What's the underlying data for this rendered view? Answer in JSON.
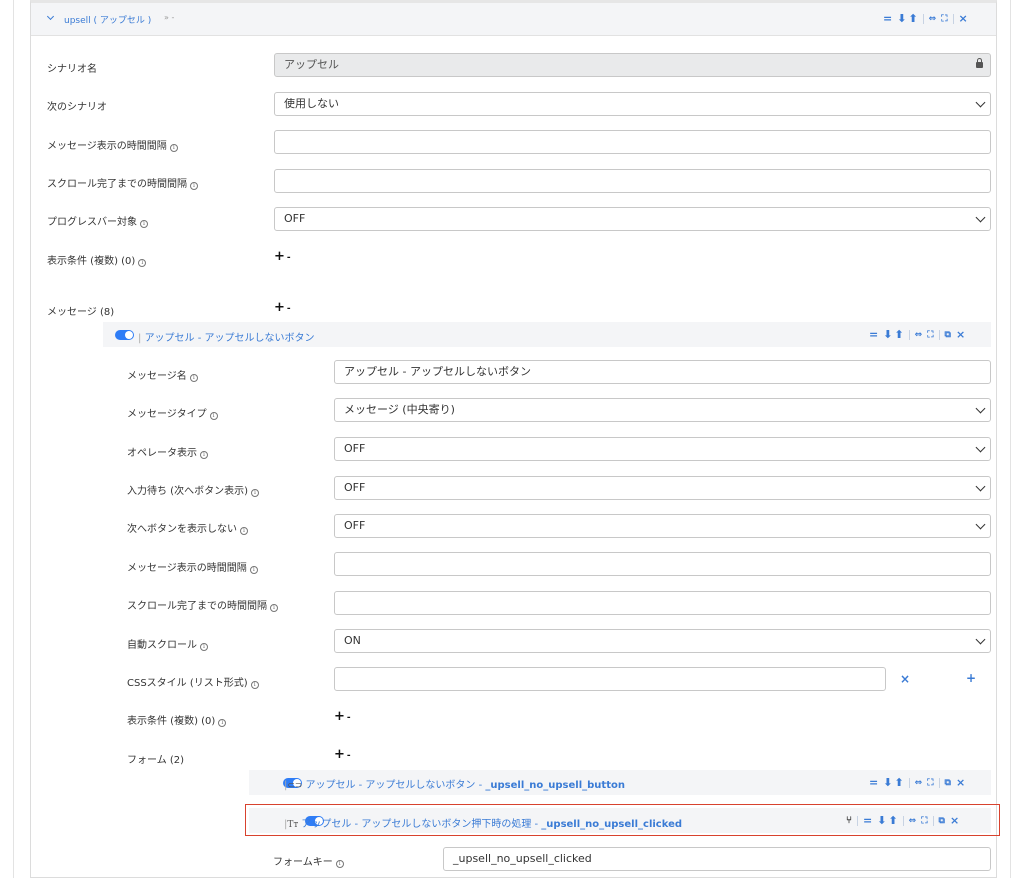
{
  "scenario": {
    "title": "upsell ( アップセル )",
    "title_suffix": "» -",
    "fields": {
      "scenario_name_label": "シナリオ名",
      "scenario_name_value": "アップセル",
      "next_scenario_label": "次のシナリオ",
      "next_scenario_value": "使用しない",
      "message_interval_label": "メッセージ表示の時間間隔",
      "scroll_interval_label": "スクロール完了までの時間間隔",
      "progress_bar_label": "プログレスバー対象",
      "progress_bar_value": "OFF",
      "display_conditions_label": "表示条件 (複数) (0)",
      "messages_label": "メッセージ (8)"
    }
  },
  "message": {
    "title": "アップセル - アップセルしないボタン",
    "fields": {
      "name_label": "メッセージ名",
      "name_value": "アップセル - アップセルしないボタン",
      "type_label": "メッセージタイプ",
      "type_value": "メッセージ (中央寄り)",
      "operator_label": "オペレータ表示",
      "operator_value": "OFF",
      "wait_input_label": "入力待ち (次へボタン表示)",
      "wait_input_value": "OFF",
      "hide_next_label": "次へボタンを表示しない",
      "hide_next_value": "OFF",
      "interval_label": "メッセージ表示の時間間隔",
      "scroll_label": "スクロール完了までの時間間隔",
      "autoscroll_label": "自動スクロール",
      "autoscroll_value": "ON",
      "css_label": "CSSスタイル (リスト形式)",
      "conditions_label": "表示条件 (複数) (0)",
      "forms_label": "フォーム (2)"
    }
  },
  "forms": [
    {
      "prefix": "アップセル - アップセルしないボタン - ",
      "key": "_upsell_no_upsell_button",
      "icon": "link-icon"
    },
    {
      "prefix": "アップセル - アップセルしないボタン押下時の処理 - ",
      "key": "_upsell_no_upsell_clicked",
      "icon": "text-icon"
    }
  ],
  "form_key": {
    "label": "フォームキー",
    "value": "_upsell_no_upsell_clicked"
  },
  "symbols": {
    "plus": "+",
    "dash": "-",
    "close": "×",
    "plus_small": "+"
  },
  "colors": {
    "accent": "#3a7bd5",
    "toggle": "#2f7df6",
    "highlight": "#d8422e"
  }
}
